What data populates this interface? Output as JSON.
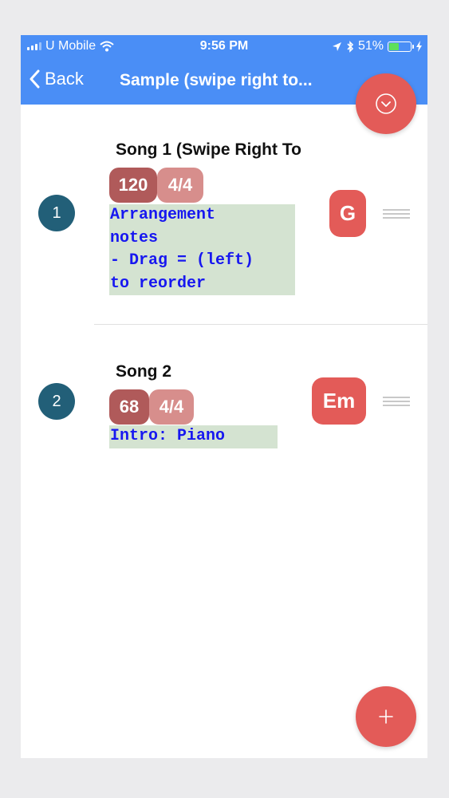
{
  "status_bar": {
    "carrier": "U Mobile",
    "time": "9:56 PM",
    "battery_percent": "51%",
    "battery_level": 0.51
  },
  "nav": {
    "back_label": "Back",
    "title": "Sample (swipe right to..."
  },
  "songs": [
    {
      "number": "1",
      "title": "Song 1 (Swipe Right To",
      "tempo": "120",
      "time_signature": "4/4",
      "notes": "Arrangement\nnotes\n- Drag = (left)\nto reorder",
      "key": "G"
    },
    {
      "number": "2",
      "title": "Song 2",
      "tempo": "68",
      "time_signature": "4/4",
      "notes": "Intro: Piano",
      "key": "Em"
    }
  ],
  "icons": {
    "collapse": "chevron-down-circle-icon",
    "add": "plus-icon",
    "drag": "drag-handle-icon",
    "back": "chevron-left-icon"
  },
  "colors": {
    "nav_blue": "#4a8ef6",
    "accent_red": "#e35b58",
    "number_badge": "#225f78",
    "tempo_tag": "#b05a5a",
    "signature_tag": "#d78e8c",
    "notes_bg": "#d4e3d1",
    "notes_text": "#1717f0"
  }
}
